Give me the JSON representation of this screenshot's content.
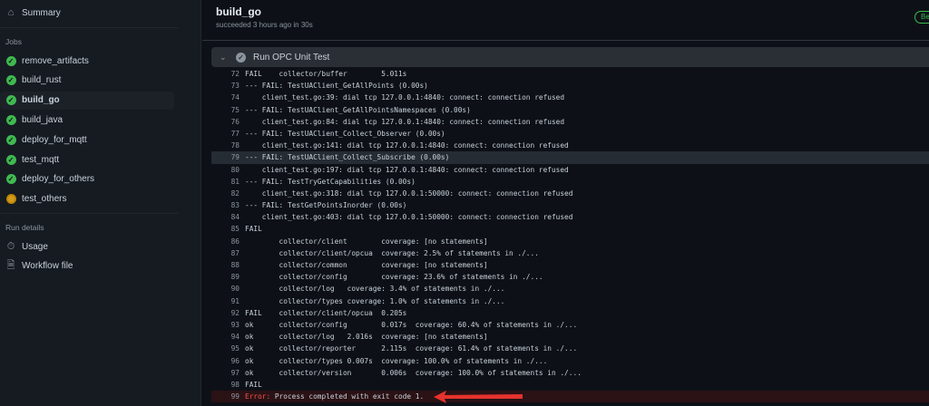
{
  "sidebar": {
    "summary": "Summary",
    "jobs_heading": "Jobs",
    "jobs": [
      {
        "label": "remove_artifacts",
        "status": "success"
      },
      {
        "label": "build_rust",
        "status": "success"
      },
      {
        "label": "build_go",
        "status": "success",
        "active": true
      },
      {
        "label": "build_java",
        "status": "success"
      },
      {
        "label": "deploy_for_mqtt",
        "status": "success"
      },
      {
        "label": "test_mqtt",
        "status": "success"
      },
      {
        "label": "deploy_for_others",
        "status": "success"
      },
      {
        "label": "test_others",
        "status": "in-progress"
      }
    ],
    "run_details_heading": "Run details",
    "usage": "Usage",
    "workflow_file": "Workflow file"
  },
  "header": {
    "title": "build_go",
    "subtitle": "succeeded 3 hours ago in 30s",
    "badge": "Be"
  },
  "step": {
    "label": "Run OPC Unit Test",
    "status": "success"
  },
  "log": [
    {
      "n": "72",
      "t": "FAIL    collector/buffer        5.011s"
    },
    {
      "n": "73",
      "t": "--- FAIL: TestUAClient_GetAllPoints (0.00s)"
    },
    {
      "n": "74",
      "t": "    client_test.go:39: dial tcp 127.0.0.1:4840: connect: connection refused"
    },
    {
      "n": "75",
      "t": "--- FAIL: TestUAClient_GetAllPointsNamespaces (0.00s)"
    },
    {
      "n": "76",
      "t": "    client_test.go:84: dial tcp 127.0.0.1:4840: connect: connection refused"
    },
    {
      "n": "77",
      "t": "--- FAIL: TestUAClient_Collect_Observer (0.00s)"
    },
    {
      "n": "78",
      "t": "    client_test.go:141: dial tcp 127.0.0.1:4840: connect: connection refused"
    },
    {
      "n": "79",
      "t": "--- FAIL: TestUAClient_Collect_Subscribe (0.00s)",
      "highlight": true
    },
    {
      "n": "80",
      "t": "    client_test.go:197: dial tcp 127.0.0.1:4840: connect: connection refused"
    },
    {
      "n": "81",
      "t": "--- FAIL: TestTryGetCapabilities (0.00s)"
    },
    {
      "n": "82",
      "t": "    client_test.go:318: dial tcp 127.0.0.1:50000: connect: connection refused"
    },
    {
      "n": "83",
      "t": "--- FAIL: TestGetPointsInorder (0.00s)"
    },
    {
      "n": "84",
      "t": "    client_test.go:403: dial tcp 127.0.0.1:50000: connect: connection refused"
    },
    {
      "n": "85",
      "t": "FAIL"
    },
    {
      "n": "86",
      "t": "        collector/client        coverage: [no statements]"
    },
    {
      "n": "87",
      "t": "        collector/client/opcua  coverage: 2.5% of statements in ./..."
    },
    {
      "n": "88",
      "t": "        collector/common        coverage: [no statements]"
    },
    {
      "n": "89",
      "t": "        collector/config        coverage: 23.6% of statements in ./..."
    },
    {
      "n": "90",
      "t": "        collector/log   coverage: 3.4% of statements in ./..."
    },
    {
      "n": "91",
      "t": "        collector/types coverage: 1.0% of statements in ./..."
    },
    {
      "n": "92",
      "t": "FAIL    collector/client/opcua  0.205s"
    },
    {
      "n": "93",
      "t": "ok      collector/config        0.017s  coverage: 60.4% of statements in ./..."
    },
    {
      "n": "94",
      "t": "ok      collector/log   2.016s  coverage: [no statements]"
    },
    {
      "n": "95",
      "t": "ok      collector/reporter      2.115s  coverage: 61.4% of statements in ./..."
    },
    {
      "n": "96",
      "t": "ok      collector/types 0.007s  coverage: 100.0% of statements in ./..."
    },
    {
      "n": "97",
      "t": "ok      collector/version       0.006s  coverage: 100.0% of statements in ./..."
    },
    {
      "n": "98",
      "t": "FAIL"
    }
  ],
  "error_line": {
    "n": "99",
    "prefix": "Error:",
    "t": " Process completed with exit code 1."
  },
  "colors": {
    "success": "#3fb950",
    "error": "#f85149",
    "annotation_arrow": "#e5322d"
  }
}
